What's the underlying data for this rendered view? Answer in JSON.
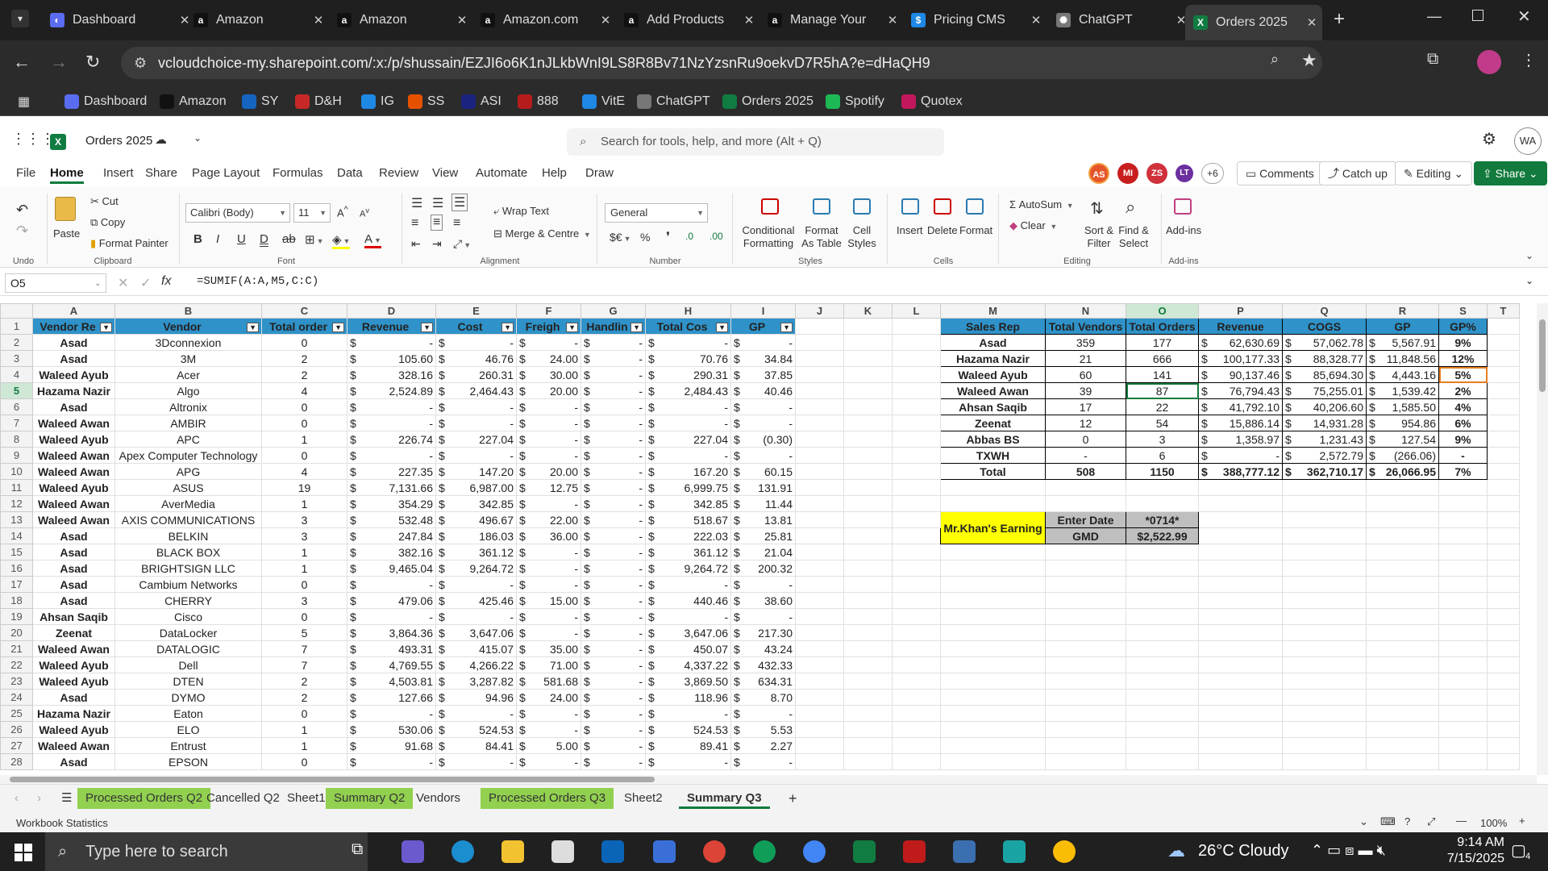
{
  "browser": {
    "tabs": [
      {
        "label": "Dashboard",
        "icon": "dashboard-favicon"
      },
      {
        "label": "Amazon",
        "icon": "amazon-favicon"
      },
      {
        "label": "Amazon",
        "icon": "amazon-favicon"
      },
      {
        "label": "Amazon.com",
        "icon": "amazon-favicon"
      },
      {
        "label": "Add Products",
        "icon": "amazon-favicon"
      },
      {
        "label": "Manage Your",
        "icon": "amazon-favicon"
      },
      {
        "label": "Pricing CMS",
        "icon": "pricing-favicon"
      },
      {
        "label": "ChatGPT",
        "icon": "chatgpt-favicon"
      },
      {
        "label": "Orders 2025",
        "icon": "excel-favicon"
      }
    ],
    "url": "vcloudchoice-my.sharepoint.com/:x:/p/shussain/EZJI6o6K1nJLkbWnI9LS8R8Bv71NzYzsnRu9oekvD7R5hA?e=dHaQH9",
    "bookmarks": [
      "Dashboard",
      "Amazon",
      "SY",
      "D&H",
      "IG",
      "SS",
      "ASI",
      "888",
      "VitE",
      "ChatGPT",
      "Orders 2025",
      "Spotify",
      "Quotex"
    ]
  },
  "app": {
    "file_name": "Orders 2025",
    "search_placeholder": "Search for tools, help, and more (Alt + Q)",
    "menus": [
      "File",
      "Home",
      "Insert",
      "Share",
      "Page Layout",
      "Formulas",
      "Data",
      "Review",
      "View",
      "Automate",
      "Help",
      "Draw"
    ],
    "collaborators": [
      "AS",
      "MI",
      "ZS",
      "LT"
    ],
    "collab_more": "+6",
    "buttons": {
      "comments": "Comments",
      "catchup": "Catch up",
      "editing": "Editing",
      "share": "Share"
    },
    "avatar": "WA"
  },
  "ribbon": {
    "undo_group": "Undo",
    "clipboard": {
      "paste": "Paste",
      "cut": "Cut",
      "copy": "Copy",
      "format_painter": "Format Painter",
      "group": "Clipboard"
    },
    "font": {
      "name": "Calibri (Body)",
      "size": "11",
      "group": "Font"
    },
    "alignment": {
      "wrap": "Wrap Text",
      "merge": "Merge & Centre",
      "group": "Alignment"
    },
    "number": {
      "format": "General",
      "group": "Number"
    },
    "styles": {
      "conditional": "Conditional Formatting",
      "format_table": "Format As Table",
      "cell_styles": "Cell Styles",
      "group": "Styles"
    },
    "cells": {
      "insert": "Insert",
      "delete": "Delete",
      "format": "Format",
      "group": "Cells"
    },
    "editing": {
      "autosum": "AutoSum",
      "clear": "Clear",
      "sort": "Sort & Filter",
      "find": "Find & Select",
      "group": "Editing"
    },
    "addins": {
      "label": "Add-ins",
      "group": "Add-ins"
    }
  },
  "formula_bar": {
    "cell_ref": "O5",
    "formula": "=SUMIF(A:A,M5,C:C)"
  },
  "columns": [
    "A",
    "B",
    "C",
    "D",
    "E",
    "F",
    "G",
    "H",
    "I",
    "J",
    "K",
    "L",
    "M",
    "N",
    "O",
    "P",
    "Q",
    "R",
    "S",
    "T"
  ],
  "left_table": {
    "headers": [
      "Vendor Re",
      "Vendor",
      "Total order",
      "Revenue",
      "Cost",
      "Freigh",
      "Handlin",
      "Total Cos",
      "GP"
    ],
    "rows": [
      [
        "Asad",
        "3Dconnexion",
        "0",
        "-",
        "-",
        "-",
        "-",
        "-",
        "-"
      ],
      [
        "Asad",
        "3M",
        "2",
        "105.60",
        "46.76",
        "24.00",
        "-",
        "70.76",
        "34.84"
      ],
      [
        "Waleed Ayub",
        "Acer",
        "2",
        "328.16",
        "260.31",
        "30.00",
        "-",
        "290.31",
        "37.85"
      ],
      [
        "Hazama Nazir",
        "Algo",
        "4",
        "2,524.89",
        "2,464.43",
        "20.00",
        "-",
        "2,484.43",
        "40.46"
      ],
      [
        "Asad",
        "Altronix",
        "0",
        "-",
        "-",
        "-",
        "-",
        "-",
        "-"
      ],
      [
        "Waleed Awan",
        "AMBIR",
        "0",
        "-",
        "-",
        "-",
        "-",
        "-",
        "-"
      ],
      [
        "Waleed Ayub",
        "APC",
        "1",
        "226.74",
        "227.04",
        "-",
        "-",
        "227.04",
        "(0.30)"
      ],
      [
        "Waleed Awan",
        "Apex Computer Technology",
        "0",
        "-",
        "-",
        "-",
        "-",
        "-",
        "-"
      ],
      [
        "Waleed Awan",
        "APG",
        "4",
        "227.35",
        "147.20",
        "20.00",
        "-",
        "167.20",
        "60.15"
      ],
      [
        "Waleed Ayub",
        "ASUS",
        "19",
        "7,131.66",
        "6,987.00",
        "12.75",
        "-",
        "6,999.75",
        "131.91"
      ],
      [
        "Waleed Awan",
        "AverMedia",
        "1",
        "354.29",
        "342.85",
        "-",
        "-",
        "342.85",
        "11.44"
      ],
      [
        "Waleed Awan",
        "AXIS COMMUNICATIONS",
        "3",
        "532.48",
        "496.67",
        "22.00",
        "-",
        "518.67",
        "13.81"
      ],
      [
        "Asad",
        "BELKIN",
        "3",
        "247.84",
        "186.03",
        "36.00",
        "-",
        "222.03",
        "25.81"
      ],
      [
        "Asad",
        "BLACK BOX",
        "1",
        "382.16",
        "361.12",
        "-",
        "-",
        "361.12",
        "21.04"
      ],
      [
        "Asad",
        "BRIGHTSIGN LLC",
        "1",
        "9,465.04",
        "9,264.72",
        "-",
        "-",
        "9,264.72",
        "200.32"
      ],
      [
        "Asad",
        "Cambium Networks",
        "0",
        "-",
        "-",
        "-",
        "-",
        "-",
        "-"
      ],
      [
        "Asad",
        "CHERRY",
        "3",
        "479.06",
        "425.46",
        "15.00",
        "-",
        "440.46",
        "38.60"
      ],
      [
        "Ahsan Saqib",
        "Cisco",
        "0",
        "-",
        "-",
        "-",
        "-",
        "-",
        "-"
      ],
      [
        "Zeenat",
        "DataLocker",
        "5",
        "3,864.36",
        "3,647.06",
        "-",
        "-",
        "3,647.06",
        "217.30"
      ],
      [
        "Waleed Awan",
        "DATALOGIC",
        "7",
        "493.31",
        "415.07",
        "35.00",
        "-",
        "450.07",
        "43.24"
      ],
      [
        "Waleed Ayub",
        "Dell",
        "7",
        "4,769.55",
        "4,266.22",
        "71.00",
        "-",
        "4,337.22",
        "432.33"
      ],
      [
        "Waleed Ayub",
        "DTEN",
        "2",
        "4,503.81",
        "3,287.82",
        "581.68",
        "-",
        "3,869.50",
        "634.31"
      ],
      [
        "Asad",
        "DYMO",
        "2",
        "127.66",
        "94.96",
        "24.00",
        "-",
        "118.96",
        "8.70"
      ],
      [
        "Hazama Nazir",
        "Eaton",
        "0",
        "-",
        "-",
        "-",
        "-",
        "-",
        "-"
      ],
      [
        "Waleed Ayub",
        "ELO",
        "1",
        "530.06",
        "524.53",
        "-",
        "-",
        "524.53",
        "5.53"
      ],
      [
        "Waleed Awan",
        "Entrust",
        "1",
        "91.68",
        "84.41",
        "5.00",
        "-",
        "89.41",
        "2.27"
      ],
      [
        "Asad",
        "EPSON",
        "0",
        "-",
        "-",
        "-",
        "-",
        "-",
        "-"
      ]
    ]
  },
  "right_table": {
    "headers": [
      "Sales Rep",
      "Total Vendors",
      "Total Orders",
      "Revenue",
      "COGS",
      "GP",
      "GP%"
    ],
    "rows": [
      [
        "Asad",
        "359",
        "177",
        "62,630.69",
        "57,062.78",
        "5,567.91",
        "9%"
      ],
      [
        "Hazama Nazir",
        "21",
        "666",
        "100,177.33",
        "88,328.77",
        "11,848.56",
        "12%"
      ],
      [
        "Waleed Ayub",
        "60",
        "141",
        "90,137.46",
        "85,694.30",
        "4,443.16",
        "5%"
      ],
      [
        "Waleed Awan",
        "39",
        "87",
        "76,794.43",
        "75,255.01",
        "1,539.42",
        "2%"
      ],
      [
        "Ahsan Saqib",
        "17",
        "22",
        "41,792.10",
        "40,206.60",
        "1,585.50",
        "4%"
      ],
      [
        "Zeenat",
        "12",
        "54",
        "15,886.14",
        "14,931.28",
        "954.86",
        "6%"
      ],
      [
        "Abbas BS",
        "0",
        "3",
        "1,358.97",
        "1,231.43",
        "127.54",
        "9%"
      ],
      [
        "TXWH",
        "-",
        "6",
        "-",
        "2,572.79",
        "(266.06)",
        "-"
      ]
    ],
    "total": [
      "Total",
      "508",
      "1150",
      "388,777.12",
      "362,710.17",
      "26,066.95",
      "7%"
    ]
  },
  "earnings": {
    "label": "Mr.Khan's Earning",
    "enter_date_label": "Enter Date",
    "enter_date_value": "*0714*",
    "gmd_label": "GMD",
    "gmd_value": "$2,522.99"
  },
  "currency_symbol": "$",
  "sheet_tabs": [
    {
      "label": "Processed Orders Q2",
      "style": "green"
    },
    {
      "label": "Cancelled Q2",
      "style": "plain"
    },
    {
      "label": "Sheet1",
      "style": "plain"
    },
    {
      "label": "Summary Q2",
      "style": "green"
    },
    {
      "label": "Vendors",
      "style": "plain"
    },
    {
      "label": "Processed Orders Q3",
      "style": "green"
    },
    {
      "label": "Sheet2",
      "style": "plain"
    },
    {
      "label": "Summary Q3",
      "style": "active"
    }
  ],
  "status": {
    "left": "Workbook Statistics",
    "zoom": "100%"
  },
  "taskbar": {
    "search": "Type here to search",
    "weather": "26°C  Cloudy",
    "time": "9:14 AM",
    "date": "7/15/2025",
    "notif": "4"
  }
}
